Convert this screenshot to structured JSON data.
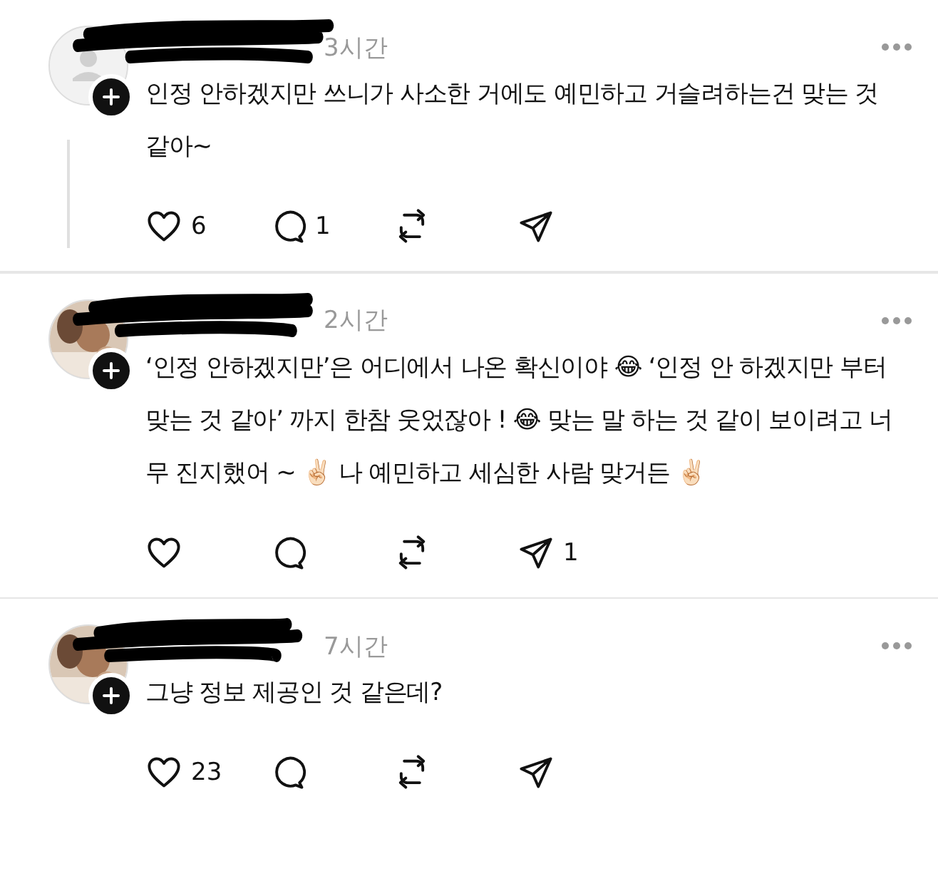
{
  "posts": [
    {
      "avatar": {
        "kind": "default"
      },
      "time": "3시간",
      "text": "인정 안하겠지만 쓰니가 사소한 거에도 예민하고 거슬려하는건 맞는 것 같아~",
      "thread_line": true,
      "divider": false,
      "actions": [
        {
          "kind": "like",
          "count": "6"
        },
        {
          "kind": "reply",
          "count": "1"
        },
        {
          "kind": "repost"
        },
        {
          "kind": "share"
        }
      ]
    },
    {
      "time": "2시간",
      "text": "‘인정 안하겠지만’은 어디에서 나온 확신이야 😂  ‘인정 안 하겠지만 부터 맞는 것 같아’ 까지 한참 웃었잖아 ! 😂 맞는 말 하는 것 같이 보이려고 너무 진지했어 ~ ✌🏻 나 예민하고 세심한 사람 맞거든 ✌🏻",
      "thread_line": false,
      "divider": true,
      "actions": [
        {
          "kind": "like"
        },
        {
          "kind": "reply"
        },
        {
          "kind": "repost"
        },
        {
          "kind": "share",
          "count": "1"
        }
      ]
    },
    {
      "time": "7시간",
      "text": "그냥 정보 제공인 것 같은데?",
      "thread_line": false,
      "divider": true,
      "actions": [
        {
          "kind": "like",
          "count": "23"
        },
        {
          "kind": "reply"
        },
        {
          "kind": "repost"
        },
        {
          "kind": "share"
        }
      ]
    }
  ]
}
